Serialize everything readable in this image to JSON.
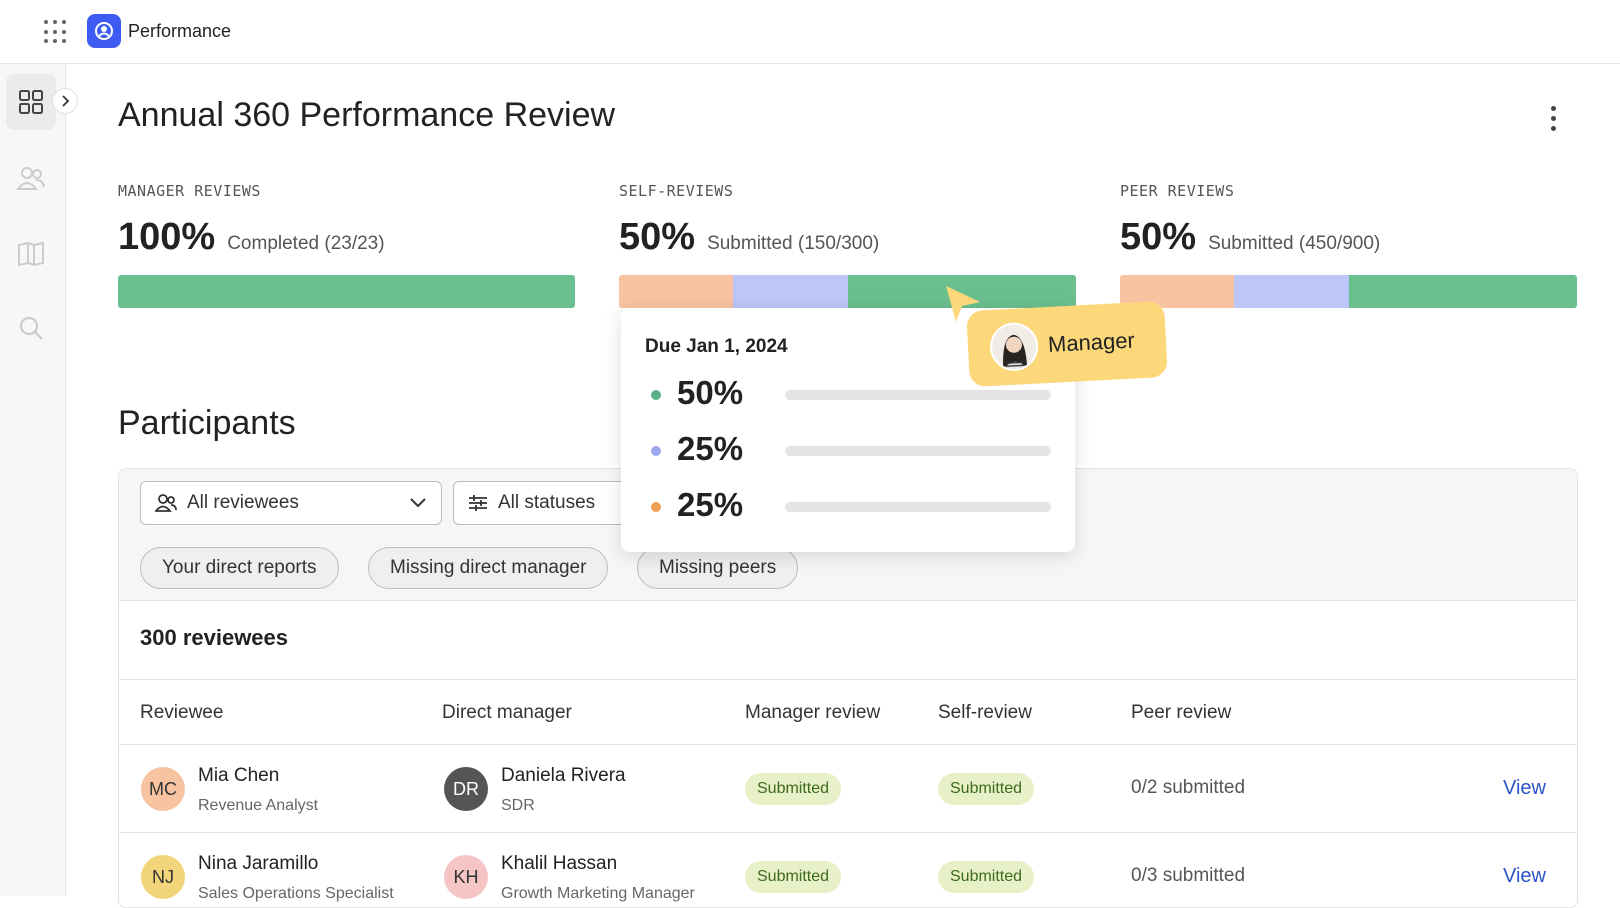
{
  "app": {
    "name": "Performance"
  },
  "page": {
    "title": "Annual 360 Performance Review"
  },
  "stats": {
    "manager": {
      "label": "MANAGER REVIEWS",
      "percent": "100%",
      "detail": "Completed (23/23)",
      "bar": [
        {
          "color": "#6abf8e",
          "fraction": 1.0
        }
      ]
    },
    "self": {
      "label": "SELF-REVIEWS",
      "percent": "50%",
      "detail": "Submitted (150/300)",
      "bar": [
        {
          "color": "#f7c3a1",
          "fraction": 0.25
        },
        {
          "color": "#bcc6f8",
          "fraction": 0.25
        },
        {
          "color": "#6abf8e",
          "fraction": 0.5
        }
      ]
    },
    "peer": {
      "label": "PEER REVIEWS",
      "percent": "50%",
      "detail": "Submitted (450/900)",
      "bar": [
        {
          "color": "#f7c3a1",
          "fraction": 0.25
        },
        {
          "color": "#bcc6f8",
          "fraction": 0.25
        },
        {
          "color": "#6abf8e",
          "fraction": 0.5
        }
      ]
    }
  },
  "tooltip": {
    "due": "Due Jan 1, 2024",
    "rows": [
      {
        "percent": "50%",
        "color": "#58ae85"
      },
      {
        "percent": "25%",
        "color": "#9ba8f0"
      },
      {
        "percent": "25%",
        "color": "#f0a050"
      }
    ]
  },
  "cursor_label": "Manager",
  "participants": {
    "title": "Participants",
    "filters": {
      "reviewees": "All reviewees",
      "statuses": "All statuses"
    },
    "chips": [
      "Your direct reports",
      "Missing direct manager",
      "Missing peers"
    ],
    "count": "300 reviewees",
    "columns": {
      "reviewee": "Reviewee",
      "manager": "Direct manager",
      "manager_review": "Manager review",
      "self_review": "Self-review",
      "peer_review": "Peer review"
    },
    "rows": [
      {
        "reviewee": {
          "initials": "MC",
          "name": "Mia Chen",
          "role": "Revenue Analyst",
          "avatar_color": "#f7c3a1"
        },
        "manager": {
          "initials": "DR",
          "name": "Daniela Rivera",
          "role": "SDR",
          "avatar_color": "#555555"
        },
        "manager_review": "Submitted",
        "self_review": "Submitted",
        "peer_review": "0/2 submitted",
        "action": "View"
      },
      {
        "reviewee": {
          "initials": "NJ",
          "name": "Nina Jaramillo",
          "role": "Sales Operations Specialist",
          "avatar_color": "#f2d47a"
        },
        "manager": {
          "initials": "KH",
          "name": "Khalil Hassan",
          "role": "Growth Marketing Manager",
          "avatar_color": "#f5c5c5"
        },
        "manager_review": "Submitted",
        "self_review": "Submitted",
        "peer_review": "0/3 submitted",
        "action": "View"
      }
    ]
  }
}
